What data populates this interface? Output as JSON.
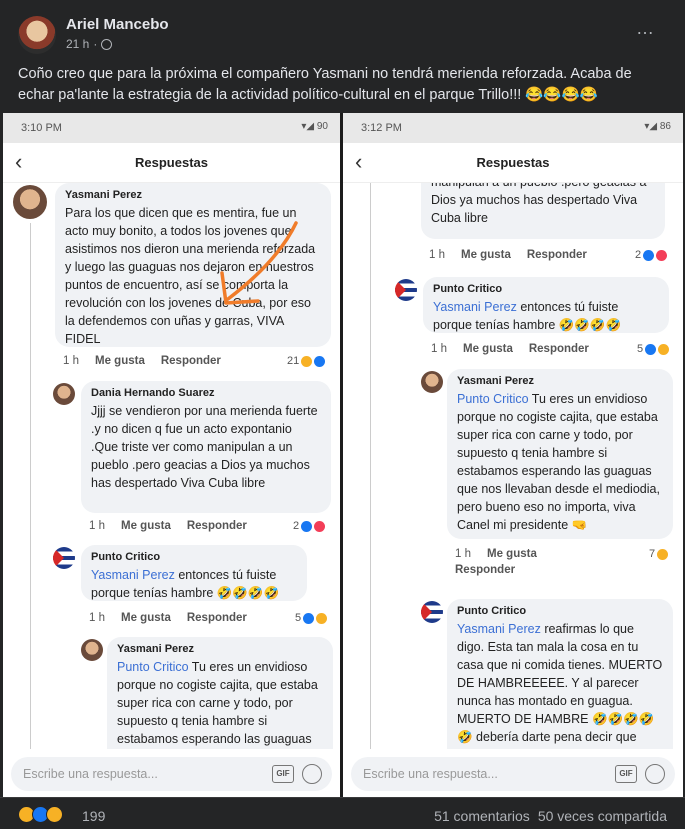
{
  "post": {
    "author": "Ariel Mancebo",
    "time": "21 h",
    "separator": "·",
    "more_icon": "…",
    "text": "Coño creo que para la próxima el compañero Yasmani no tendrá merienda reforzada. Acaba de echar pa'lante la estrategia de la actividad político-cultural en el parque Trillo!!! 😂😂😂😂"
  },
  "left_phone": {
    "status_time": "3:10 PM",
    "status_right": "▾◢ 90",
    "header_title": "Respuestas",
    "comments": [
      {
        "name": "Yasmani Perez",
        "mention": "",
        "text": "Para los que dicen que es mentira, fue un acto muy bonito, a todos los jovenes que asistimos nos dieron una merienda reforzada y luego las guaguas nos dejaron en nuestros puntos de encuentro, así se comporta la revolución con los jovenes de Cuba, por eso la defendemos con uñas y garras, VIVA FIDEL",
        "time": "1 h",
        "like": "Me gusta",
        "reply": "Responder",
        "count": "21"
      },
      {
        "name": "Dania Hernando Suarez",
        "mention": "",
        "text": "Jjjj se vendieron por una merienda fuerte .y no dicen q fue un acto expontanio .Que triste ver como manipulan a un pueblo .pero geacias a Dios ya muchos has despertado Viva Cuba libre",
        "time": "1 h",
        "like": "Me gusta",
        "reply": "Responder",
        "count": "2"
      },
      {
        "name": "Punto Critico",
        "mention": "Yasmani Perez",
        "text": " entonces tú fuiste porque tenías hambre 🤣🤣🤣🤣",
        "time": "1 h",
        "like": "Me gusta",
        "reply": "Responder",
        "count": "5"
      },
      {
        "name": "Yasmani Perez",
        "mention": "Punto Critico",
        "text": " Tu eres un envidioso porque no cogiste cajita, que estaba super rica con carne y todo, por supuesto q tenia hambre si estabamos esperando las guaguas que nos"
      }
    ],
    "compose_placeholder": "Escribe una respuesta...",
    "gif_label": "GIF"
  },
  "right_phone": {
    "status_time": "3:12 PM",
    "status_right": "▾◢ 86",
    "header_title": "Respuestas",
    "comments": [
      {
        "name": "",
        "mention": "",
        "text": "manipulan a un pueblo .pero geacias a Dios ya muchos has despertado Viva Cuba libre",
        "time": "1 h",
        "like": "Me gusta",
        "reply": "Responder",
        "count": "2"
      },
      {
        "name": "Punto Critico",
        "mention": "Yasmani Perez",
        "text": " entonces tú fuiste porque tenías hambre 🤣🤣🤣🤣",
        "time": "1 h",
        "like": "Me gusta",
        "reply": "Responder",
        "count": "5"
      },
      {
        "name": "Yasmani Perez",
        "mention": "Punto Critico",
        "text": " Tu eres un envidioso porque no cogiste cajita, que estaba super rica con carne y todo, por supuesto q tenia hambre si estabamos esperando las guaguas que nos llevaban desde el mediodia, pero bueno eso no importa, viva Canel mi presidente 🤜",
        "time": "1 h",
        "like": "Me gusta",
        "reply": "Responder",
        "count": "7"
      },
      {
        "name": "Punto Critico",
        "mention": "Yasmani Perez",
        "text": " reafirmas lo que digo. Esta tan mala la cosa en tu casa que ni comida tienes. MUERTO DE HAMBREEEEE. Y al parecer nunca has montado en guagua. MUERTO DE HAMBRE 🤣🤣🤣🤣🤣 debería darte pena decir que fuiste espontáneamente a comete una"
      }
    ],
    "compose_placeholder": "Escribe una respuesta...",
    "gif_label": "GIF"
  },
  "footer": {
    "reaction_count": "199",
    "comments": "51 comentarios",
    "shares": "50 veces compartida"
  },
  "colors": {
    "background": "#242526",
    "mention": "#3b6fd4",
    "annotation_arrow": "#f07c2a"
  }
}
